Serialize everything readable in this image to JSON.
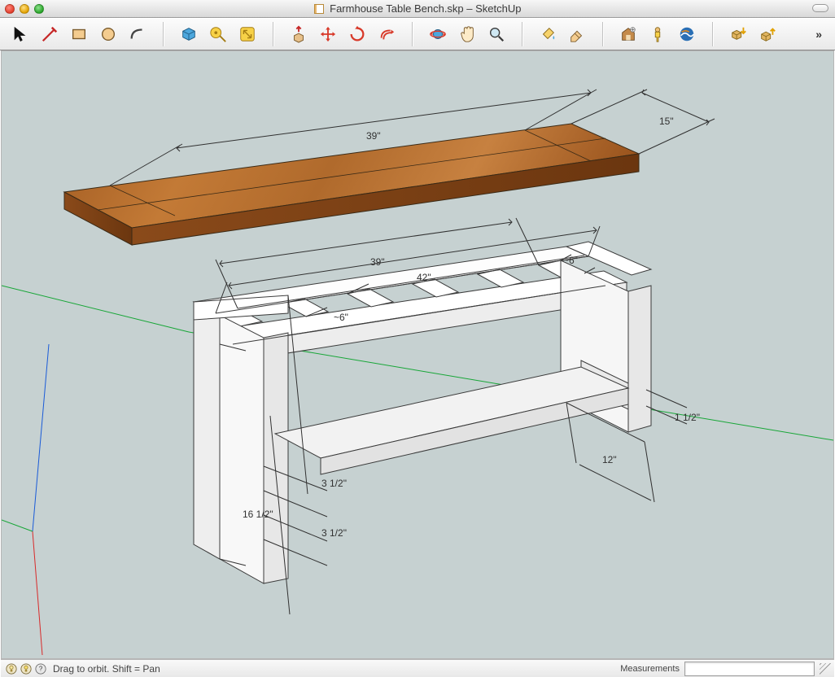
{
  "window": {
    "title": "Farmhouse Table Bench.skp – SketchUp"
  },
  "toolbar": {
    "items": [
      "select-tool",
      "line-tool",
      "rectangle-tool",
      "circle-tool",
      "arc-tool",
      "SEP",
      "make-component-tool",
      "tape-measure-tool",
      "dimension-tool",
      "SEP",
      "push-pull-tool",
      "move-tool",
      "rotate-tool",
      "offset-tool",
      "SEP",
      "orbit-tool",
      "pan-tool",
      "zoom-tool",
      "SEP",
      "paint-bucket-tool",
      "eraser-tool",
      "SEP",
      "3d-warehouse-tool",
      "place-person-tool",
      "google-earth-tool",
      "SEP",
      "get-model-tool",
      "share-model-tool"
    ]
  },
  "viewport": {
    "dimensions": {
      "seat_length": "39\"",
      "seat_depth": "15\"",
      "frame_inner": "39\"",
      "frame_outer": "42\"",
      "slat_gap_front": "~6\"",
      "slat_gap_end": "~6\"",
      "leg_depth": "12\"",
      "stretcher_thick": "1 1/2\"",
      "leg_width_upper": "3 1/2\"",
      "leg_width_lower": "3 1/2\"",
      "leg_height": "16 1/2\""
    }
  },
  "status": {
    "hint": "Drag to orbit.  Shift = Pan",
    "meas_label": "Measurements",
    "meas_value": ""
  }
}
